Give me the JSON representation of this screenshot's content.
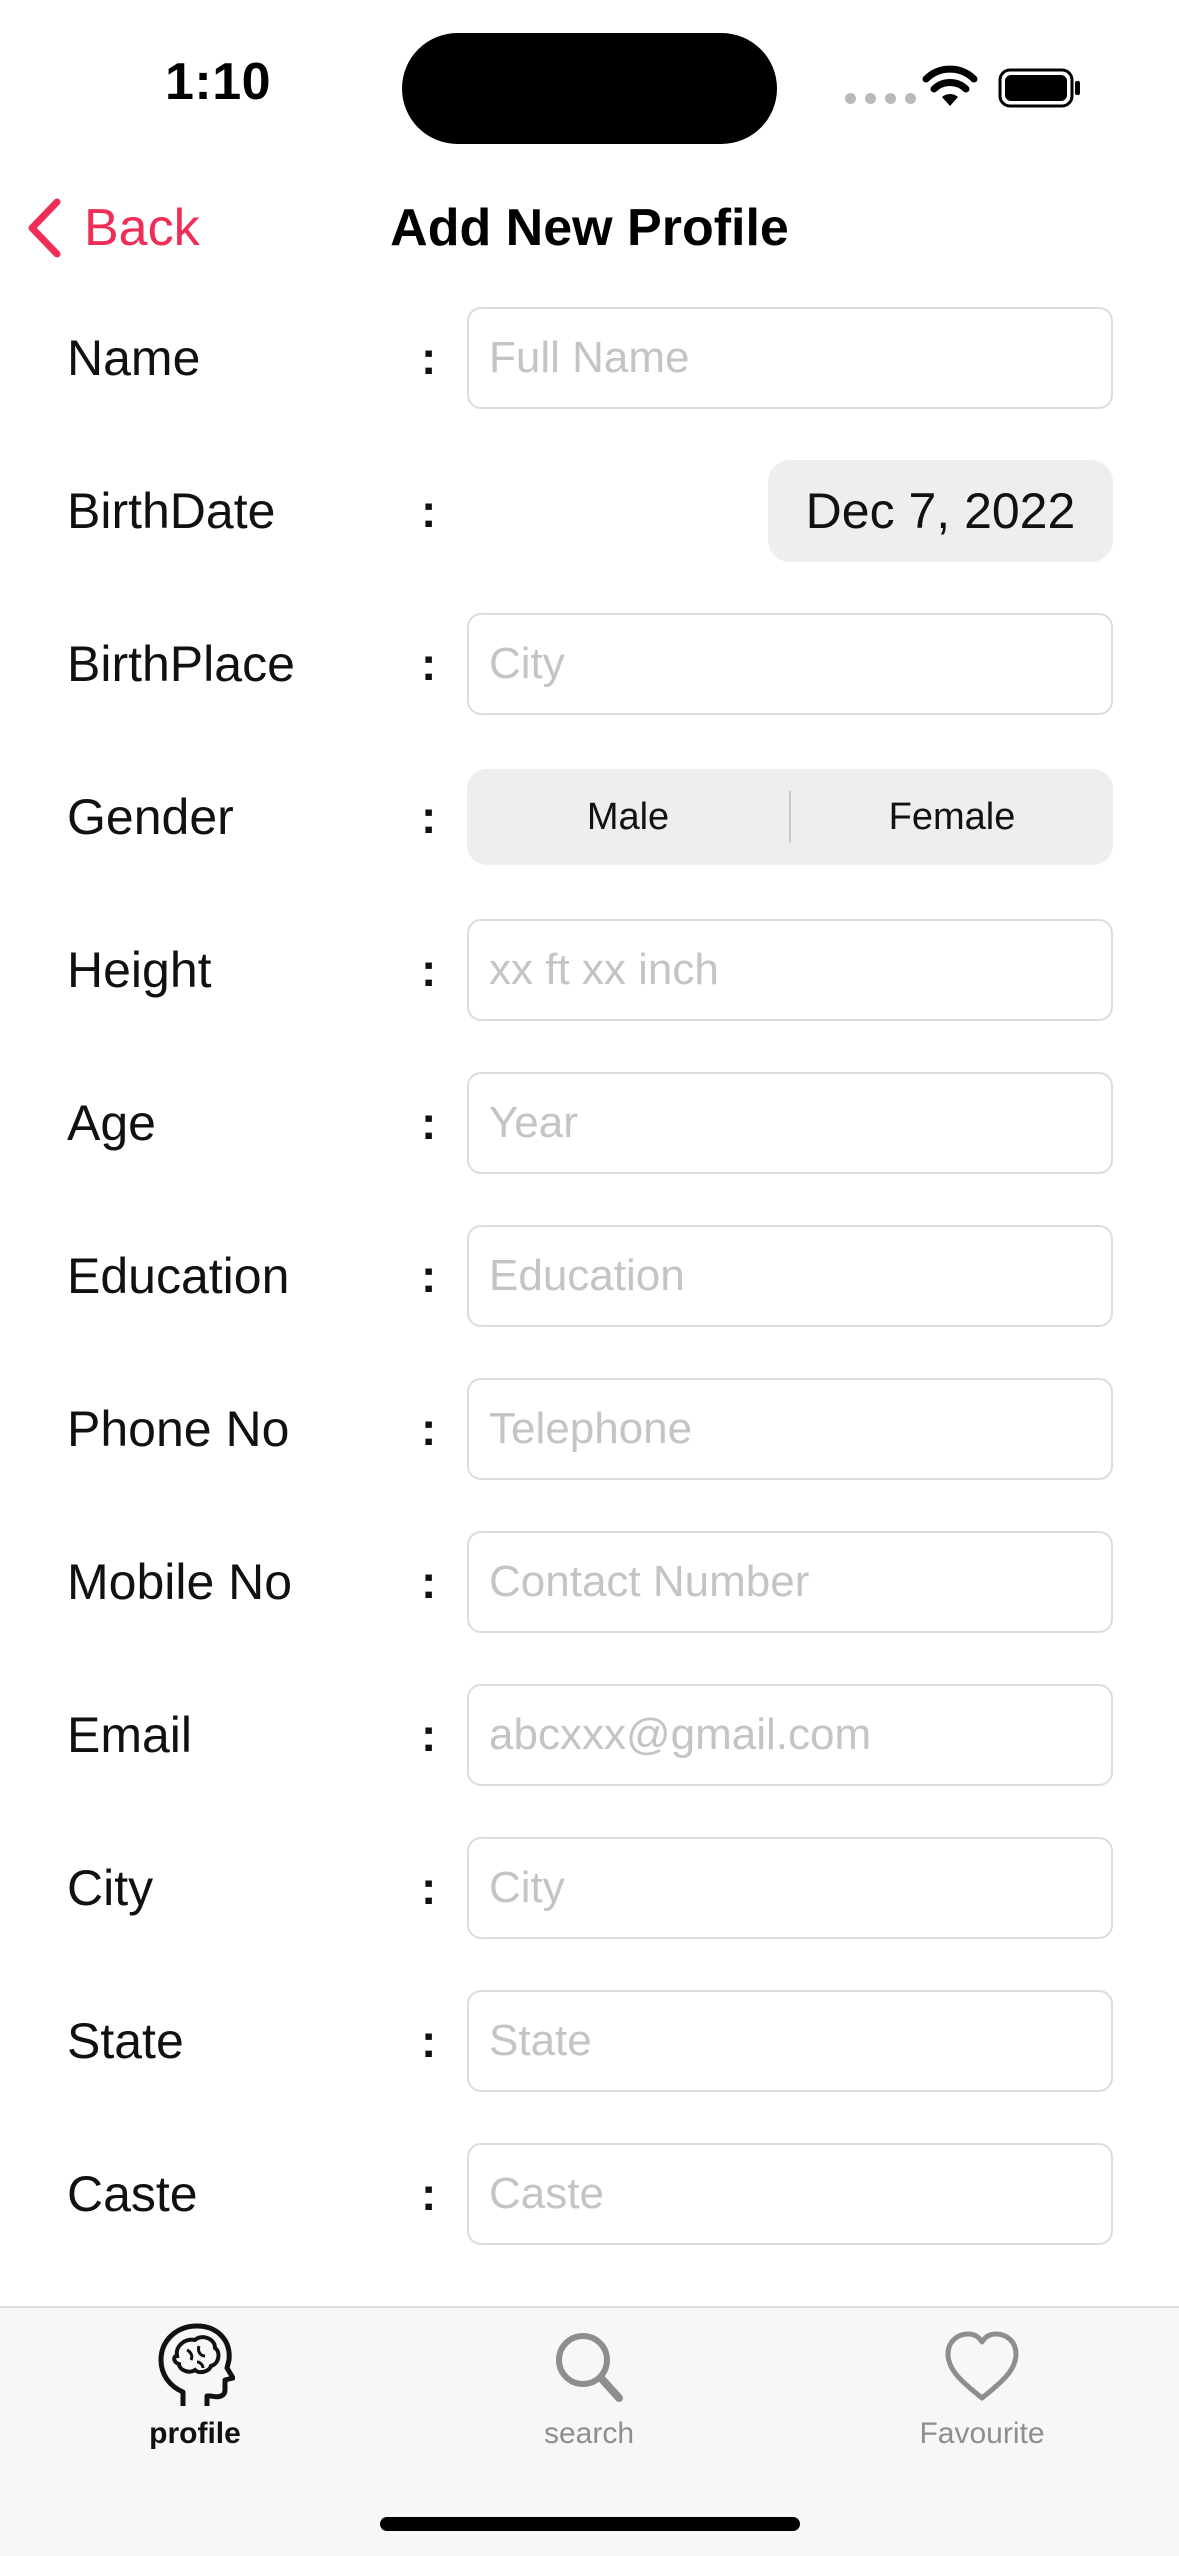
{
  "status_bar": {
    "time": "1:10"
  },
  "nav": {
    "back_label": "Back",
    "title": "Add New Profile"
  },
  "colon": ":",
  "form": {
    "name": {
      "label": "Name",
      "placeholder": "Full Name"
    },
    "birthdate": {
      "label": "BirthDate",
      "value": "Dec 7, 2022"
    },
    "birthplace": {
      "label": "BirthPlace",
      "placeholder": "City"
    },
    "gender": {
      "label": "Gender",
      "options": [
        "Male",
        "Female"
      ]
    },
    "height": {
      "label": "Height",
      "placeholder": "xx ft xx inch"
    },
    "age": {
      "label": "Age",
      "placeholder": "Year"
    },
    "education": {
      "label": "Education",
      "placeholder": "Education"
    },
    "phone": {
      "label": "Phone No",
      "placeholder": "Telephone"
    },
    "mobile": {
      "label": "Mobile No",
      "placeholder": "Contact Number"
    },
    "email": {
      "label": "Email",
      "placeholder": "abcxxx@gmail.com"
    },
    "city": {
      "label": "City",
      "placeholder": "City"
    },
    "state": {
      "label": "State",
      "placeholder": "State"
    },
    "caste": {
      "label": "Caste",
      "placeholder": "Caste"
    }
  },
  "tabbar": {
    "tabs": [
      {
        "label": "profile",
        "icon": "brain-head-icon",
        "active": true
      },
      {
        "label": "search",
        "icon": "magnifier-icon",
        "active": false
      },
      {
        "label": "Favourite",
        "icon": "heart-icon",
        "active": false
      }
    ]
  },
  "colors": {
    "accent": "#ef2d56",
    "placeholder": "#c4c4c4",
    "pill_bg": "#eeeeef"
  }
}
